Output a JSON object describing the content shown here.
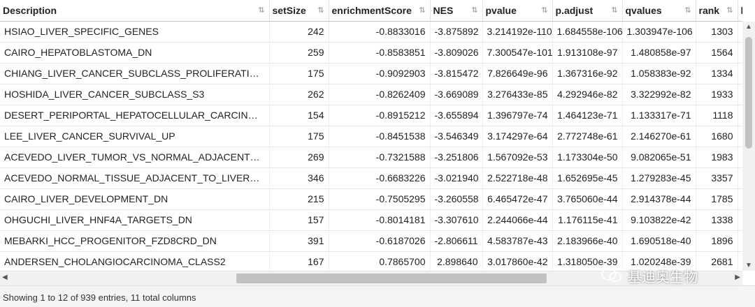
{
  "table": {
    "columns": [
      "Description",
      "setSize",
      "enrichmentScore",
      "NES",
      "pvalue",
      "p.adjust",
      "qvalues",
      "rank",
      "l"
    ],
    "rows": [
      [
        "HSIAO_LIVER_SPECIFIC_GENES",
        "242",
        "-0.8833016",
        "-3.875892",
        "3.214192e-110",
        "1.684558e-106",
        "1.303947e-106",
        "1303"
      ],
      [
        "CAIRO_HEPATOBLASTOMA_DN",
        "259",
        "-0.8583851",
        "-3.809026",
        "7.300547e-101",
        "1.913108e-97",
        "1.480858e-97",
        "1564"
      ],
      [
        "CHIANG_LIVER_CANCER_SUBCLASS_PROLIFERATION_DN",
        "175",
        "-0.9092903",
        "-3.815472",
        "7.826649e-96",
        "1.367316e-92",
        "1.058383e-92",
        "1334"
      ],
      [
        "HOSHIDA_LIVER_CANCER_SUBCLASS_S3",
        "262",
        "-0.8262409",
        "-3.669089",
        "3.276433e-85",
        "4.292946e-82",
        "3.322992e-82",
        "1933"
      ],
      [
        "DESERT_PERIPORTAL_HEPATOCELLULAR_CARCINOMA_SUBC...",
        "154",
        "-0.8915212",
        "-3.655894",
        "1.396797e-74",
        "1.464123e-71",
        "1.133317e-71",
        "1118"
      ],
      [
        "LEE_LIVER_CANCER_SURVIVAL_UP",
        "175",
        "-0.8451538",
        "-3.546349",
        "3.174297e-64",
        "2.772748e-61",
        "2.146270e-61",
        "1680"
      ],
      [
        "ACEVEDO_LIVER_TUMOR_VS_NORMAL_ADJACENT_TISSUE_...",
        "269",
        "-0.7321588",
        "-3.251806",
        "1.567092e-53",
        "1.173304e-50",
        "9.082065e-51",
        "1983"
      ],
      [
        "ACEVEDO_NORMAL_TISSUE_ADJACENT_TO_LIVER_TUMOR_...",
        "346",
        "-0.6683226",
        "-3.021940",
        "2.522718e-48",
        "1.652695e-45",
        "1.279283e-45",
        "3357"
      ],
      [
        "CAIRO_LIVER_DEVELOPMENT_DN",
        "215",
        "-0.7505295",
        "-3.260558",
        "6.465472e-47",
        "3.765060e-44",
        "2.914378e-44",
        "1785"
      ],
      [
        "OHGUCHI_LIVER_HNF4A_TARGETS_DN",
        "157",
        "-0.8014181",
        "-3.307610",
        "2.244066e-44",
        "1.176115e-41",
        "9.103822e-42",
        "1338"
      ],
      [
        "MEBARKI_HCC_PROGENITOR_FZD8CRD_DN",
        "391",
        "-0.6187026",
        "-2.806611",
        "4.583787e-43",
        "2.183966e-40",
        "1.690518e-40",
        "1896"
      ],
      [
        "ANDERSEN_CHOLANGIOCARCINOMA_CLASS2",
        "167",
        "0.7865700",
        "2.898640",
        "3.017860e-42",
        "1.318050e-39",
        "1.020248e-39",
        "2681"
      ]
    ]
  },
  "footer": {
    "info": "Showing 1 to 12 of 939 entries, 11 total columns"
  },
  "watermark": {
    "text": "基迪奥生物"
  },
  "icons": {
    "sort": "sort-arrows-icon",
    "scroll_up": "scroll-up-icon",
    "scroll_down": "scroll-down-icon",
    "scroll_left": "scroll-left-icon",
    "scroll_right": "scroll-right-icon"
  }
}
